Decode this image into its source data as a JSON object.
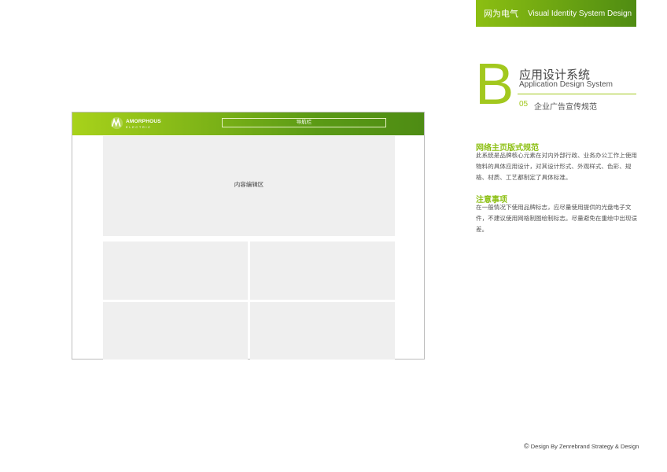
{
  "header_banner": {
    "cn": "网为电气",
    "en": "Visual Identity System Design"
  },
  "section": {
    "letter": "B",
    "title_cn": "应用设计系统",
    "title_en": "Application Design System",
    "number": "05",
    "page_title": "企业广告宣传规范"
  },
  "spec": {
    "heading1": "网络主页版式规范",
    "para1": "此系统是品牌核心元素在对内外部行政、业务办公工作上使用物料的具体应用设计，对其设计形式、外观样式、色彩、规格、材质、工艺都制定了具体标准。",
    "heading2": "注意事项",
    "para2": "在一般情况下使用品牌标志，应尽量使用提供的光盘电子文件，不建议使用网格制图绘制标志。尽量避免在重绘中出现误差。"
  },
  "mockup": {
    "logo_main": "AMORPHOUS",
    "logo_sub": "ELECTRIC",
    "nav_label": "导航栏",
    "content_label": "内容编辑区",
    "colors": {
      "header_start": "#a8d21a",
      "header_end": "#4e8c14",
      "block": "#efefef"
    }
  },
  "footer": {
    "symbol": "©",
    "text": "Design By Zenrebrand Strategy & Design"
  },
  "colors": {
    "accent": "#8cbf12",
    "letter": "#a2c81e"
  }
}
